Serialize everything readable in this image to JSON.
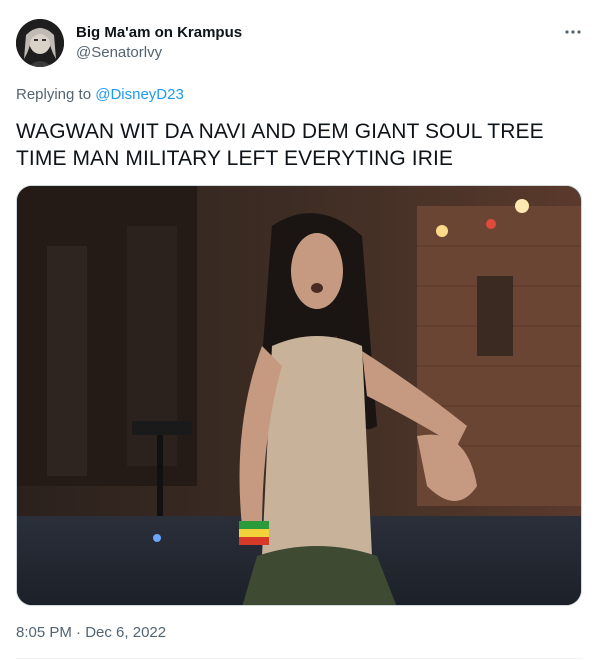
{
  "author": {
    "display_name": "Big Ma'am on Krampus",
    "handle": "@Senatorlvy"
  },
  "reply": {
    "prefix": "Replying to",
    "mention": "@DisneyD23"
  },
  "tweet": {
    "text_line1": "WAGWAN WIT DA NAVI AND DEM GIANT SOUL TREE",
    "text_line2": "TIME MAN MILITARY LEFT EVERYTING IRIE"
  },
  "media": {
    "type": "image"
  },
  "meta": {
    "time": "8:05 PM",
    "separator": "·",
    "date": "Dec 6, 2022"
  },
  "icons": {
    "more": "more-horizontal-icon"
  },
  "colors": {
    "text": "#0f1419",
    "secondary": "#536471",
    "link": "#1d9bf0",
    "border": "#cfd9de"
  }
}
